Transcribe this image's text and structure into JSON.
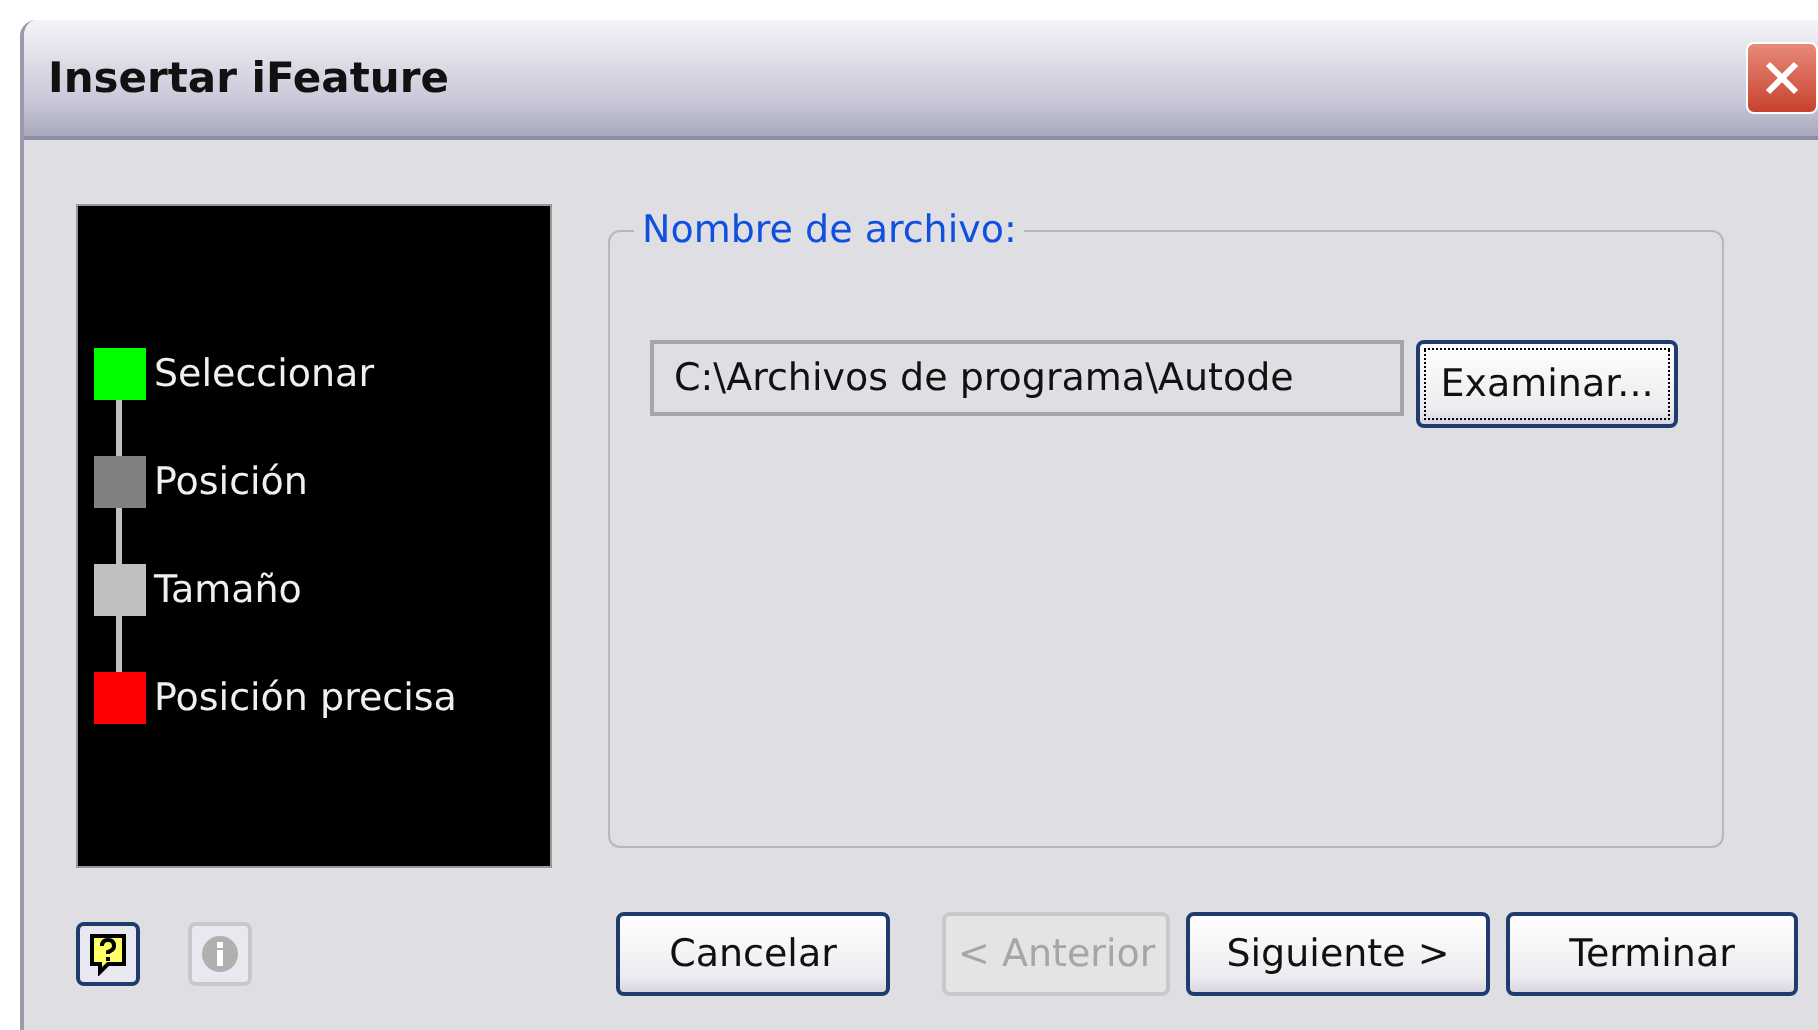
{
  "window": {
    "title": "Insertar iFeature"
  },
  "steps": [
    {
      "label": "Seleccionar",
      "color": "#00ff00"
    },
    {
      "label": "Posición",
      "color": "#808080"
    },
    {
      "label": "Tamaño",
      "color": "#c0c0c0"
    },
    {
      "label": "Posición precisa",
      "color": "#ff0000"
    }
  ],
  "file_group": {
    "legend": "Nombre de archivo:",
    "value": "C:\\Archivos de programa\\Autode",
    "browse": {
      "label": "Examinar...",
      "focused": true
    }
  },
  "help_buttons": [
    {
      "kind": "help",
      "disabled": false
    },
    {
      "kind": "info",
      "disabled": true
    }
  ],
  "buttons": [
    {
      "label": "Cancelar",
      "disabled": false
    },
    {
      "label": "< Anterior",
      "disabled": true
    },
    {
      "label": "Siguiente >",
      "disabled": false
    },
    {
      "label": "Terminar",
      "disabled": false
    }
  ]
}
